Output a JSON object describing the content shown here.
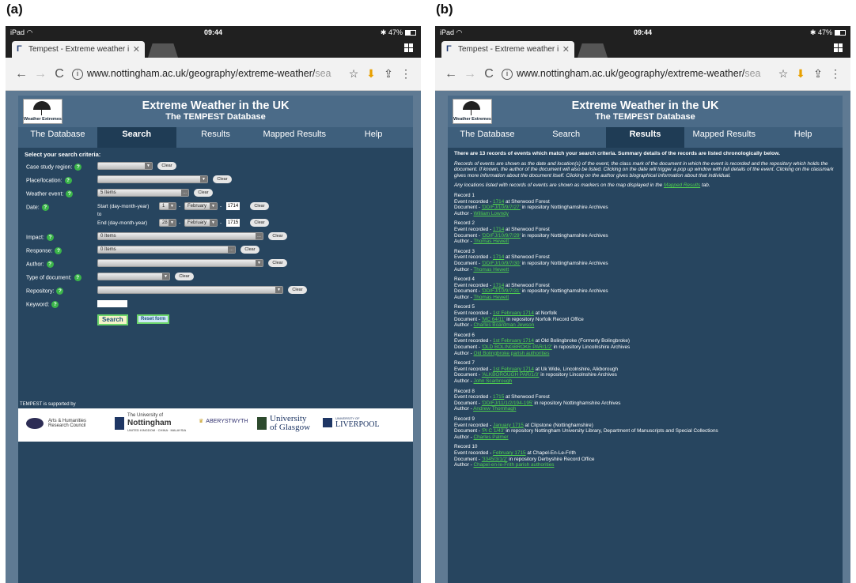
{
  "labels": {
    "a": "(a)",
    "b": "(b)"
  },
  "device": {
    "left": "iPad",
    "time": "09:44",
    "battery": "47%"
  },
  "tab": {
    "title": "Tempest - Extreme weather i"
  },
  "url": {
    "main": "www.nottingham.ac.uk/geography/extreme-weather/",
    "tail": "sea"
  },
  "site": {
    "logo": "Weather Extremes",
    "title": "Extreme Weather in the UK",
    "subtitle": "The TEMPEST Database",
    "nav": [
      "The Database",
      "Search",
      "Results",
      "Mapped Results",
      "Help"
    ]
  },
  "search": {
    "heading": "Select your search criteria:",
    "case_study": "Case study region:",
    "place": "Place/location:",
    "weather": "Weather event:",
    "weather_val": "5 Items",
    "date": "Date:",
    "start": "Start (day-month-year)",
    "to": "to",
    "end": "End (day-month-year)",
    "start_day": "1",
    "start_month": "February",
    "start_year": "1714",
    "end_day": "28",
    "end_month": "February",
    "end_year": "1715",
    "impact": "Impact:",
    "impact_val": "0 Items",
    "response": "Response:",
    "response_val": "0 Items",
    "author": "Author:",
    "doctype": "Type of document:",
    "repository": "Repository:",
    "keyword": "Keyword:",
    "clear": "Clear",
    "search_btn": "Search",
    "reset_btn": "Reset form",
    "dash": "-"
  },
  "sponsors": {
    "supported": "TEMPEST is supported by",
    "ahrc": "Arts & Humanities Research Council",
    "nott_small": "The University of",
    "nott": "Nottingham",
    "nott_sub": "UNITED KINGDOM · CHINA · MALAYSIA",
    "aber": "ABERYSTWYTH",
    "glasgow1": "University",
    "glasgow2": "of Glasgow",
    "liv1": "UNIVERSITY OF",
    "liv2": "LIVERPOOL"
  },
  "results": {
    "heading": "There are 13 records of events which match your search criteria. Summary details of the records are listed chronologically below.",
    "intro1": "Records of events are shown as the date and location(s) of the event, the class mark of the document in which the event is recorded and the repository which holds the document. If known, the author of the document will also be listed. Clicking on the date will trigger a pop up window with full details of the event. Clicking on the classmark gives more information about the document itself. Clicking on the author gives biographical information about that individual.",
    "intro2_pre": "Any locations listed with records of events are shown as markers on the map displayed in the ",
    "intro2_link": "Mapped Results",
    "intro2_post": " tab.",
    "ev": "Event recorded - ",
    "doc": "Document - ",
    "repo": " in repository ",
    "auth": "Author - ",
    "records": [
      {
        "label": "Record 1",
        "date": "1714",
        "place": " at Sherwood Forest",
        "doc": "'DD/FJ/10/9/7/27'",
        "repo": "Nottinghamshire Archives",
        "author": "William Lowndy"
      },
      {
        "label": "Record 2",
        "date": "1714",
        "place": " at Sherwood Forest",
        "doc": "'DD/FJ/10/9/7/29'",
        "repo": "Nottinghamshire Archives",
        "author": "Thomas Hewett"
      },
      {
        "label": "Record 3",
        "date": "1714",
        "place": " at Sherwood Forest",
        "doc": "'DD/FJ/10/9/7/30'",
        "repo": "Nottinghamshire Archives",
        "author": "Thomas Hewett"
      },
      {
        "label": "Record 4",
        "date": "1714",
        "place": " at Sherwood Forest",
        "doc": "'DD/FJ/10/9/7/31'",
        "repo": "Nottinghamshire Archives",
        "author": "Thomas Hewett"
      },
      {
        "label": "Record 5",
        "date": "1st February 1714",
        "place": " at Norfolk",
        "doc": "'MC 64/11'",
        "repo": "Norfolk Record Office",
        "author": "Charles Boardman Jewson"
      },
      {
        "label": "Record 6",
        "date": "1st February 1714",
        "place": " at Old Bolingbroke (Formerly Bolingbroke)",
        "doc": "'OLD BOLINGBROKE PAR/1/2'",
        "repo": "Lincolnshire Archives",
        "author": "Old Bolingbroke parish authorities"
      },
      {
        "label": "Record 7",
        "date": "1st February 1714",
        "place": " at Uk Wide, Lincolnshire, Alkborough",
        "doc": "'ALKBOROUGH PAR/1/3'",
        "repo": "Lincolnshire Archives",
        "author": "John Scarbrough"
      },
      {
        "label": "Record 8",
        "date": "1715",
        "place": " at Sherwood Forest",
        "doc": "'DD/FJ/11/1/2/194-195'",
        "repo": "Nottinghamshire Archives",
        "author": "Andrew Thornhagh"
      },
      {
        "label": "Record 9",
        "date": "January 1715",
        "place": " at Clipstone (Nottinghamshire)",
        "doc": "'Pl C 1/43'",
        "repo": "Nottingham University Library, Department of Manuscripts and Special Collections",
        "author": "Charles Palmer"
      },
      {
        "label": "Record 10",
        "date": "February 1715",
        "place": " at Chapel-En-Le-Frith",
        "doc": "'3345/3/1/2'",
        "repo": "Derbyshire Record Office",
        "author": "Chapel-en-le-Frith parish authorities"
      }
    ]
  }
}
